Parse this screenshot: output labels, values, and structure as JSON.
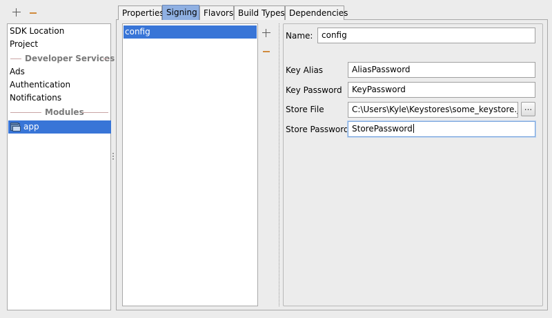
{
  "toolbar": {
    "add_icon": "plus-icon",
    "remove_icon": "minus-icon"
  },
  "sidebar": {
    "items": [
      {
        "label": "SDK Location"
      },
      {
        "label": "Project"
      }
    ],
    "group_developer": "Developer Services",
    "developer_items": [
      {
        "label": "Ads"
      },
      {
        "label": "Authentication"
      },
      {
        "label": "Notifications"
      }
    ],
    "group_modules": "Modules",
    "modules": [
      {
        "label": "app",
        "icon": "module-folder-icon",
        "selected": true
      }
    ]
  },
  "tabs": [
    {
      "label": "Properties",
      "active": false
    },
    {
      "label": "Signing",
      "active": true
    },
    {
      "label": "Flavors",
      "active": false
    },
    {
      "label": "Build Types",
      "active": false
    },
    {
      "label": "Dependencies",
      "active": false
    }
  ],
  "configs": {
    "items": [
      {
        "label": "config",
        "selected": true
      }
    ]
  },
  "form": {
    "name_label": "Name:",
    "name_value": "config",
    "key_alias_label": "Key Alias",
    "key_alias_value": "AliasPassword",
    "key_password_label": "Key Password",
    "key_password_value": "KeyPassword",
    "store_file_label": "Store File",
    "store_file_value": "C:\\Users\\Kyle\\Keystores\\some_keystore.jks",
    "browse_label": "...",
    "store_password_label": "Store Password",
    "store_password_value": "StorePassword"
  },
  "colors": {
    "selection": "#3875d7",
    "active_tab": "#8fb0e2",
    "remove_icon": "#d08a3c"
  }
}
